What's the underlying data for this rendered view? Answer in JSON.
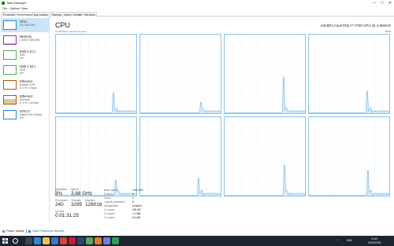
{
  "window": {
    "title": "Task Manager",
    "minimize": "—",
    "maximize": "□",
    "close": "✕"
  },
  "menu": [
    "File",
    "Options",
    "View"
  ],
  "tabs": [
    "Processes",
    "Performance",
    "App history",
    "Startup",
    "Users",
    "Details",
    "Services"
  ],
  "active_tab": "Performance",
  "sidebar": {
    "items": [
      {
        "name": "CPU",
        "sub1": "3%  3.68 GHz",
        "sub2": "",
        "color": "#1f8ad1",
        "level": 0.05
      },
      {
        "name": "Memory",
        "sub1": "1.5/16.0 GB (9%)",
        "sub2": "",
        "color": "#8b2fb8",
        "level": 0.1
      },
      {
        "name": "Disk 0 (C:)",
        "sub1": "SSD",
        "sub2": "0%",
        "color": "#4caf50",
        "level": 0
      },
      {
        "name": "Disk 1 (D:)",
        "sub1": "HDD",
        "sub2": "0%",
        "color": "#4caf50",
        "level": 0
      },
      {
        "name": "Ethernet",
        "sub1": "Radmin VPN",
        "sub2": "S: 0  R: 0 Kbps",
        "color": "#a65c00",
        "level": 0
      },
      {
        "name": "Ethernet",
        "sub1": "Ethernet",
        "sub2": "S: 0  R: 1.6 Kbps",
        "color": "#a65c00",
        "level": 0.6
      },
      {
        "name": "GPU 0",
        "sub1": "Intel(R) HD Graphi...",
        "sub2": "1%",
        "color": "#1f8ad1",
        "level": 0.02
      }
    ]
  },
  "main": {
    "title": "CPU",
    "model": "Intel(R) Core(TM) i7-7700 CPU @ 3.60GHz",
    "util_label": "% Utilization over 60 seconds",
    "util_max": "100%",
    "graph_color": "#8fc4e6",
    "graphs": [
      {
        "spike": 0.26,
        "spike_at": 0.71
      },
      {
        "spike": 0.14,
        "spike_at": 0.75
      },
      {
        "spike": 0.46,
        "spike_at": 0.73
      },
      {
        "spike": 0.28,
        "spike_at": 0.72
      },
      {
        "spike": 0.2,
        "spike_at": 0.74
      },
      {
        "spike": 0.22,
        "spike_at": 0.72
      },
      {
        "spike": 0.39,
        "spike_at": 0.74
      },
      {
        "spike": 0.32,
        "spike_at": 0.73
      }
    ]
  },
  "stats": {
    "utilization_label": "Utilization",
    "utilization": "3%",
    "speed_label": "Speed",
    "speed": "3,68 GHz",
    "processes_label": "Processes",
    "processes": "240",
    "threads_label": "Threads",
    "threads": "3295",
    "handles_label": "Handles",
    "handles": "128018",
    "uptime_label": "Up time",
    "uptime": "0:01:31:25",
    "details": [
      {
        "k": "Base speed:",
        "v": "3.60 GHz"
      },
      {
        "k": "Sockets:",
        "v": "1"
      },
      {
        "k": "Cores:",
        "v": "4"
      },
      {
        "k": "Logical processors:",
        "v": "8"
      },
      {
        "k": "Virtualization:",
        "v": "Enabled"
      },
      {
        "k": "L1 cache:",
        "v": "256 KB"
      },
      {
        "k": "L2 cache:",
        "v": "1.0 MB"
      },
      {
        "k": "L3 cache:",
        "v": "8.0 MB"
      }
    ]
  },
  "footer": {
    "fewer_details": "Fewer details",
    "open_rm": "Open Resource Monitor"
  },
  "taskbar": {
    "apps": [
      {
        "name": "task-view-icon",
        "color": "#3b4656"
      },
      {
        "name": "edge-icon",
        "color": "#2a8bd6"
      },
      {
        "name": "file-explorer-icon",
        "color": "#f2c14e"
      },
      {
        "name": "store-icon",
        "color": "#3b77c8"
      },
      {
        "name": "chrome-icon",
        "color": "#d9453a"
      },
      {
        "name": "opera-icon",
        "color": "#cc1b2b"
      },
      {
        "name": "steam-icon",
        "color": "#27486b"
      },
      {
        "name": "app-icon",
        "color": "#5aa469"
      },
      {
        "name": "media-icon",
        "color": "#e07a2d"
      },
      {
        "name": "discord-icon",
        "color": "#6f7ee0"
      },
      {
        "name": "task-manager-icon",
        "color": "#2f9e5a"
      }
    ],
    "lang": "ENG",
    "time": "13:49",
    "date": "2022/07/28"
  }
}
